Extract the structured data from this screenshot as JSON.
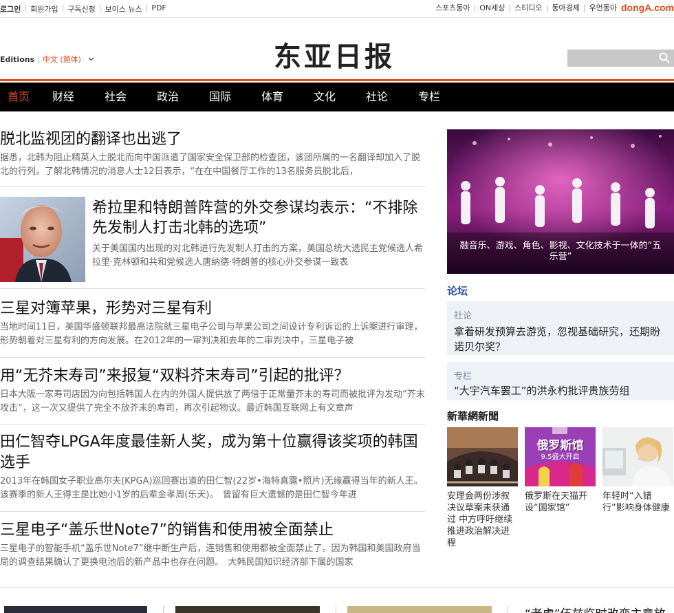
{
  "topbar": {
    "left": [
      "로그인",
      "회원가입",
      "구독신청",
      "보이스 뉴스",
      "PDF"
    ],
    "right": [
      "스포츠동아",
      "ON세상",
      "스티디오",
      "동아경제",
      "우먼동아"
    ],
    "brand": "dongA.com"
  },
  "masthead": {
    "editions_label": "Editions",
    "language": "中文 (簡体)",
    "logo": "东亚日报",
    "search_placeholder": ""
  },
  "nav": [
    "首页",
    "财经",
    "社会",
    "政治",
    "国际",
    "体育",
    "文化",
    "社论",
    "专栏"
  ],
  "stories": [
    {
      "title": "脱北监视团的翻译也出逃了",
      "summary": "据悉，北韩为阻止精英人士脱北而向中国派遣了国家安全保卫部的检查团，该团所属的一名翻译却加入了脱北的行列。了解北韩情况的消息人士12日表示，“在在中国餐厅工作的13名服务员脱北后，"
    },
    {
      "title": "希拉里和特朗普阵营的外交参谋均表示：“不排除先发制人打击北韩的选项”",
      "summary": "关于美国国内出现的对北韩进行先发制人打击的方案，美国总统大选民主党候选人希拉里·克林顿和共和党候选人唐纳德·特朗普的核心外交参谋一致表"
    },
    {
      "title": "三星对簿苹果，形势对三星有利",
      "summary": "当地时间11日，美国华盛顿联邦最高法院就三星电子公司与苹果公司之间设计专利诉讼的上诉案进行审理，形势朝着对三星有利的方向发展。在2012年的一审判决和去年的二审判决中，三星电子被"
    },
    {
      "title": "用“无芥末寿司”来报复“双料芥末寿司”引起的批评？",
      "summary": "日本大阪一家寿司店因为向包括韩国人在内的外国人提供放了两倍于正常量芥末的寿司而被批评为发动“芥末攻击”，这一次又提供了完全不放芥末的寿司，再次引起物议。最近韩国互联网上有文章声"
    },
    {
      "title": "田仁智夺LPGA年度最佳新人奖，成为第十位赢得该奖项的韩国选手",
      "summary": "2013年在韩国女子职业高尔夫(KPGA)巡回赛出道的田仁智(22岁•海特真露•照片)无缘赢得当年的新人王。该赛季的新人王得主是比她小1岁的后辈金孝周(乐天)。　曾留有巨大遗憾的是田仁智今年进"
    },
    {
      "title": "三星电子“盖乐世Note7”的销售和使用被全面禁止",
      "summary": "三星电子的智能手机“盖乐世Note7”继中断生产后，连销售和使用都被全面禁止了。因为韩国和美国政府当局的调查结果确认了更换电池后的新产品中也存在问题。　大韩民国知识经济部下属的国家"
    }
  ],
  "feature": {
    "caption": "融音乐、游戏、角色、影视、文化技术于一体的“五乐营”"
  },
  "forum": {
    "heading": "论坛",
    "items": [
      {
        "category": "社论",
        "title": "拿着研发预算去游览，忽视基础研究，还期盼诺贝尔奖？"
      },
      {
        "category": "专栏",
        "title": "“大宇汽车罢工”的洪永杓批评贵族劳组"
      }
    ]
  },
  "xinhua": {
    "heading": "新華網新聞",
    "cards": [
      {
        "caption": "安理会两份涉叙决议草案未获通过 中方呼吁继续推进政治解决进程"
      },
      {
        "caption": "俄罗斯在天猫开设“国家馆”",
        "banner_title": "俄罗斯馆",
        "banner_sub": "9.5盛大开启"
      },
      {
        "caption": "年轻时“入错行”影响身体健康"
      }
    ]
  },
  "bottom": {
    "headline": "“老虎”伍兹临时改变主意放"
  },
  "colors": {
    "accent": "#e64b19",
    "forum_blue": "#2c4fa3",
    "nav_bg": "#000000"
  }
}
